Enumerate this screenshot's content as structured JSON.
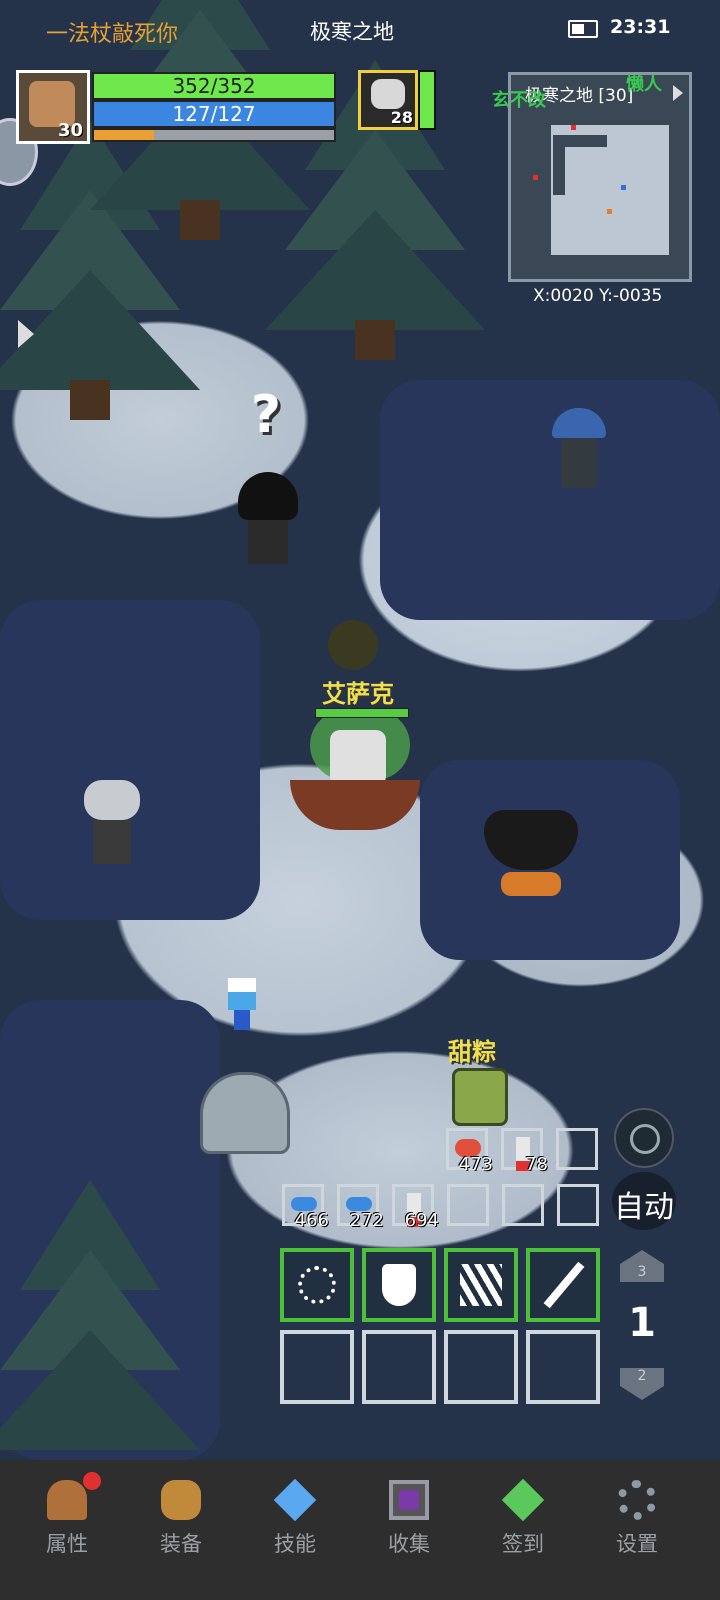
{
  "status_bar": {
    "guild_name": "一法杖敲死你",
    "map_name": "极寒之地",
    "time": "23:31"
  },
  "player": {
    "level": "30",
    "hp": "352/352",
    "mp": "127/127",
    "exp_fraction": 0.25
  },
  "target": {
    "level": "28",
    "hp_fraction": 1.0
  },
  "minimap": {
    "title": "极寒之地 [30]",
    "coords": "X:0020  Y:-0035",
    "overlay_name_1": "玄不改",
    "overlay_name_2": "懒人"
  },
  "world": {
    "npc_name": "艾萨克",
    "pet_name": "甜粽",
    "quest_marker": "?"
  },
  "items": {
    "row1": [
      {
        "icon": "meat-icon",
        "count": "473"
      },
      {
        "icon": "potion-red-icon",
        "count": "78"
      },
      {
        "icon": "",
        "count": ""
      }
    ],
    "row2": [
      {
        "icon": "fish-icon",
        "count": "466"
      },
      {
        "icon": "fish-icon",
        "count": "272"
      },
      {
        "icon": "potion-red-icon",
        "count": "694"
      },
      {
        "icon": "",
        "count": ""
      },
      {
        "icon": "",
        "count": ""
      },
      {
        "icon": "",
        "count": ""
      }
    ]
  },
  "skills": [
    {
      "icon": "burst-icon"
    },
    {
      "icon": "shield-slash-icon"
    },
    {
      "icon": "claw-icon"
    },
    {
      "icon": "sword-icon"
    }
  ],
  "controls": {
    "auto_label": "自动",
    "page_up": "3",
    "page_current": "1",
    "page_down": "2"
  },
  "nav": [
    {
      "label": "属性",
      "icon": "helmet-icon",
      "badge": true
    },
    {
      "label": "装备",
      "icon": "bag-icon",
      "badge": false
    },
    {
      "label": "技能",
      "icon": "skill-orb-icon",
      "badge": false
    },
    {
      "label": "收集",
      "icon": "collection-box-icon",
      "badge": false
    },
    {
      "label": "签到",
      "icon": "gem-icon",
      "badge": false
    },
    {
      "label": "设置",
      "icon": "gear-icon",
      "badge": false
    }
  ],
  "colors": {
    "hp": "#6ee84a",
    "mp": "#3a86e0",
    "exp": "#e8a032",
    "skill_border": "#4cc038",
    "name_yellow": "#f0e050"
  }
}
